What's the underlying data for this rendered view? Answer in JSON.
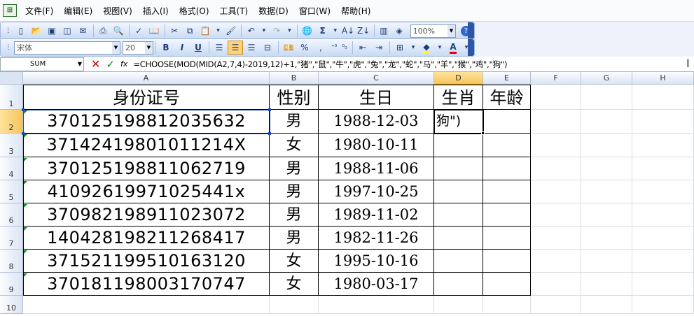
{
  "menu": [
    "文件(F)",
    "编辑(E)",
    "视图(V)",
    "插入(I)",
    "格式(O)",
    "工具(T)",
    "数据(D)",
    "窗口(W)",
    "帮助(H)"
  ],
  "toolbar": {
    "zoom": "100%",
    "font_name": "宋体",
    "font_size": "20",
    "bold": "B",
    "italic": "I",
    "underline": "U",
    "sum": "Σ",
    "percent": "%",
    "comma": ","
  },
  "formula_bar": {
    "name_box": "SUM",
    "formula": "=CHOOSE(MOD(MID(A2,7,4)-2019,12)+1,\"猪\",\"鼠\",\"牛\",\"虎\",\"兔\",\"龙\",\"蛇\",\"马\",\"羊\",\"猴\",\"鸡\",\"狗\")"
  },
  "columns": [
    "A",
    "B",
    "C",
    "D",
    "E",
    "F",
    "G",
    "H"
  ],
  "rows": [
    "1",
    "2",
    "3",
    "4",
    "5",
    "6",
    "7",
    "8",
    "9",
    "10"
  ],
  "headers": {
    "id": "身份证号",
    "gender": "性别",
    "birthday": "生日",
    "zodiac": "生肖",
    "age": "年龄"
  },
  "active_cell_text": "狗\")",
  "records": [
    {
      "id": "370125198812035632",
      "gender": "男",
      "birthday": "1988-12-03"
    },
    {
      "id": "37142419801011214X",
      "gender": "女",
      "birthday": "1980-10-11"
    },
    {
      "id": "370125198811062719",
      "gender": "男",
      "birthday": "1988-11-06"
    },
    {
      "id": "41092619971025441x",
      "gender": "男",
      "birthday": "1997-10-25"
    },
    {
      "id": "370982198911023072",
      "gender": "男",
      "birthday": "1989-11-02"
    },
    {
      "id": "140428198211268417",
      "gender": "男",
      "birthday": "1982-11-26"
    },
    {
      "id": "371521199510163120",
      "gender": "女",
      "birthday": "1995-10-16"
    },
    {
      "id": "370181198003170747",
      "gender": "女",
      "birthday": "1980-03-17"
    }
  ],
  "colors": {
    "accent": "#f5c55b",
    "header_bg": "#dbe4f3",
    "toolbar": "#c9daf4"
  }
}
